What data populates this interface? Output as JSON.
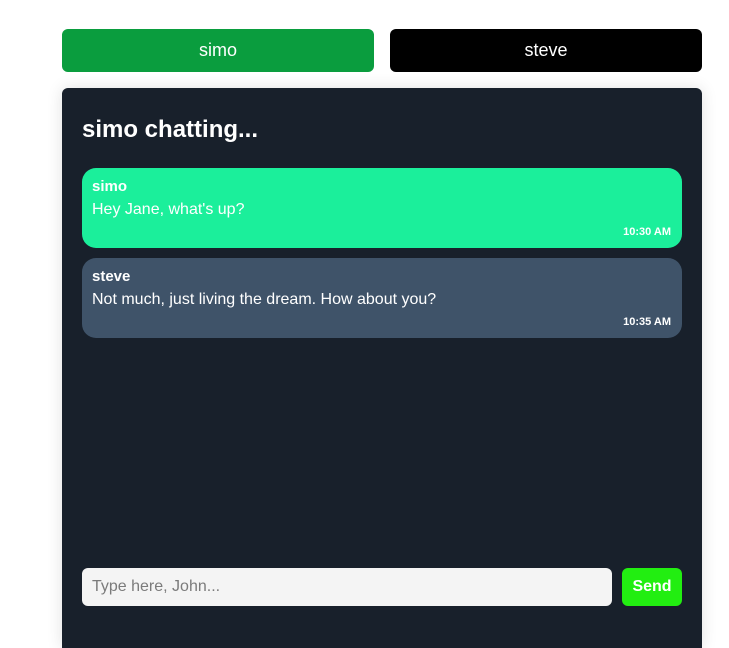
{
  "users": [
    {
      "name": "simo",
      "active": true
    },
    {
      "name": "steve",
      "active": false
    }
  ],
  "chat": {
    "title": "simo chatting...",
    "messages": [
      {
        "sender": "simo",
        "text": "Hey Jane, what's up?",
        "time": "10:30 AM",
        "own": true
      },
      {
        "sender": "steve",
        "text": "Not much, just living the dream. How about you?",
        "time": "10:35 AM",
        "own": false
      }
    ]
  },
  "composer": {
    "placeholder": "Type here, John...",
    "send_label": "Send"
  },
  "colors": {
    "active_user": "#0a9d3e",
    "inactive_user": "#000000",
    "panel": "#18202b",
    "own_message": "#1bef9b",
    "other_message": "#3f5369",
    "send": "#22ee11"
  }
}
